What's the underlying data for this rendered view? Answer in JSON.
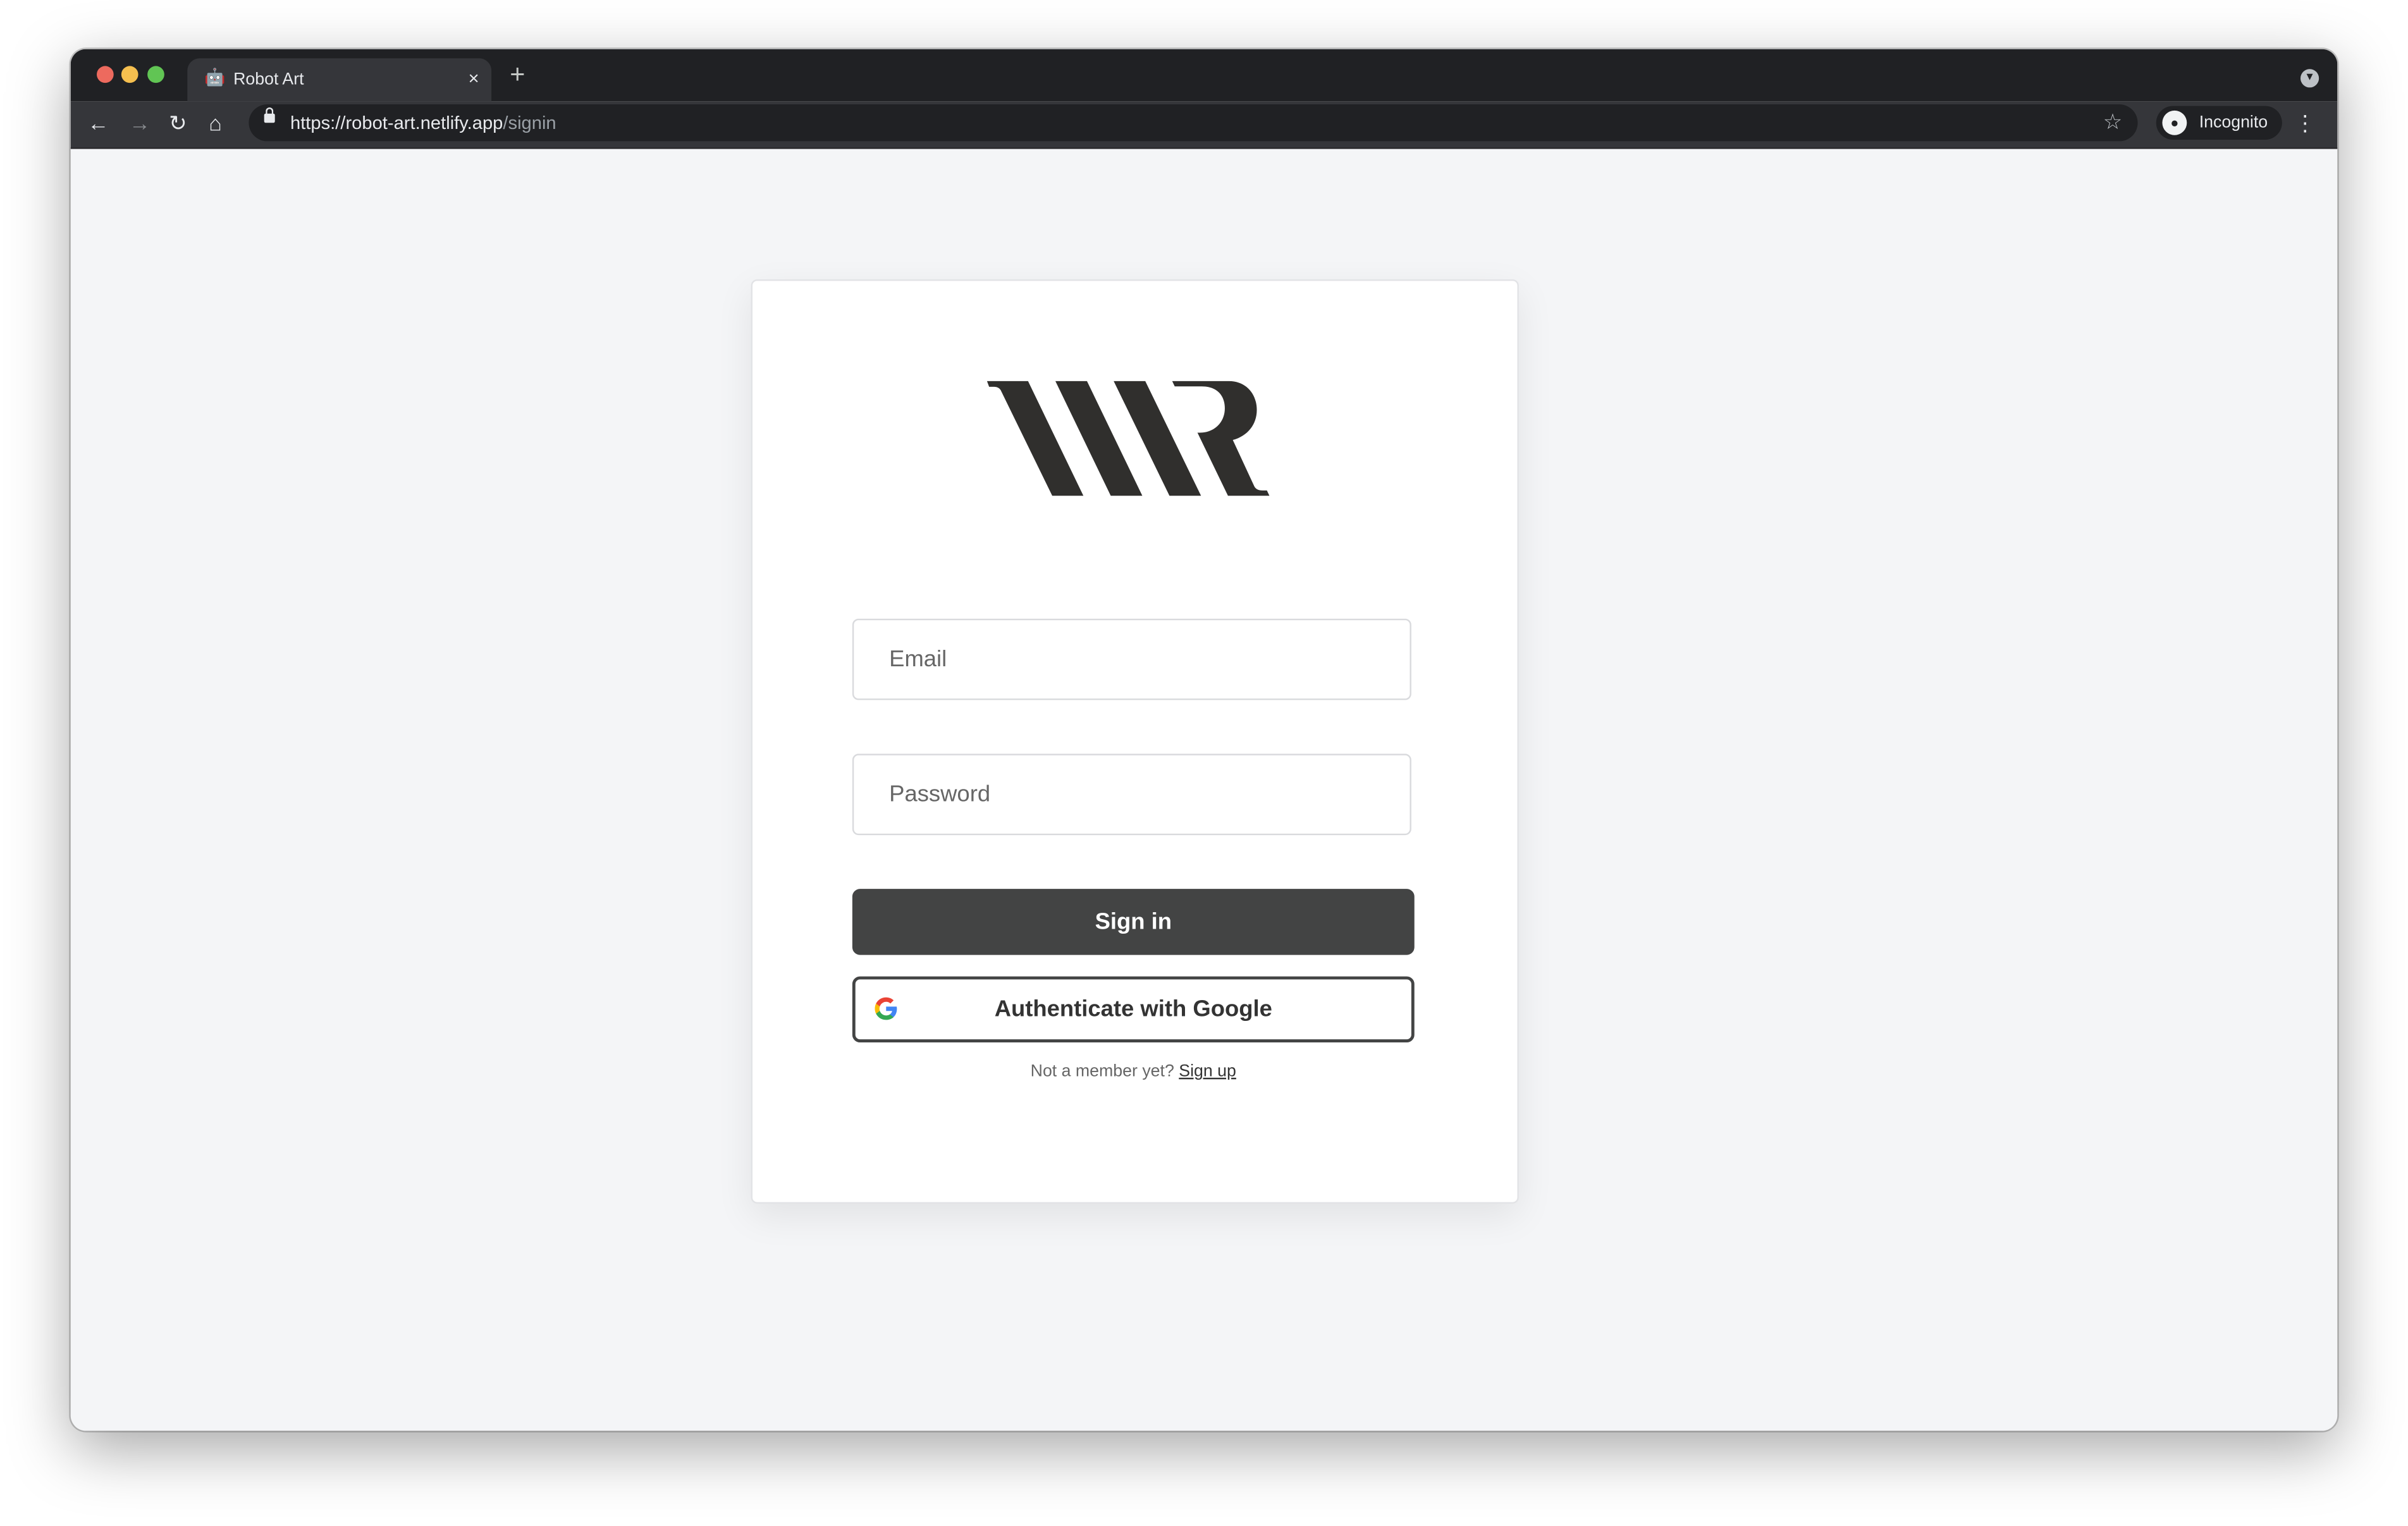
{
  "browser": {
    "tab_title": "Robot Art",
    "tab_favicon": "robot-emoji",
    "tab_close": "×",
    "new_tab": "+",
    "url_host": "https://robot-art.netlify.app",
    "url_path": "/signin",
    "profile_label": "Incognito",
    "traffic_lights": {
      "close": "#ed6a5e",
      "minimize": "#f5bf4f",
      "maximize": "#61c554"
    }
  },
  "logo": {
    "text": "WR"
  },
  "form": {
    "email_placeholder": "Email",
    "password_placeholder": "Password",
    "signin_label": "Sign in",
    "google_label": "Authenticate with Google",
    "signup_prompt": "Not a member yet?",
    "signup_link": "Sign up"
  },
  "colors": {
    "primary_button": "#434444",
    "page_bg": "#f4f5f7",
    "logo": "#302f2d"
  }
}
